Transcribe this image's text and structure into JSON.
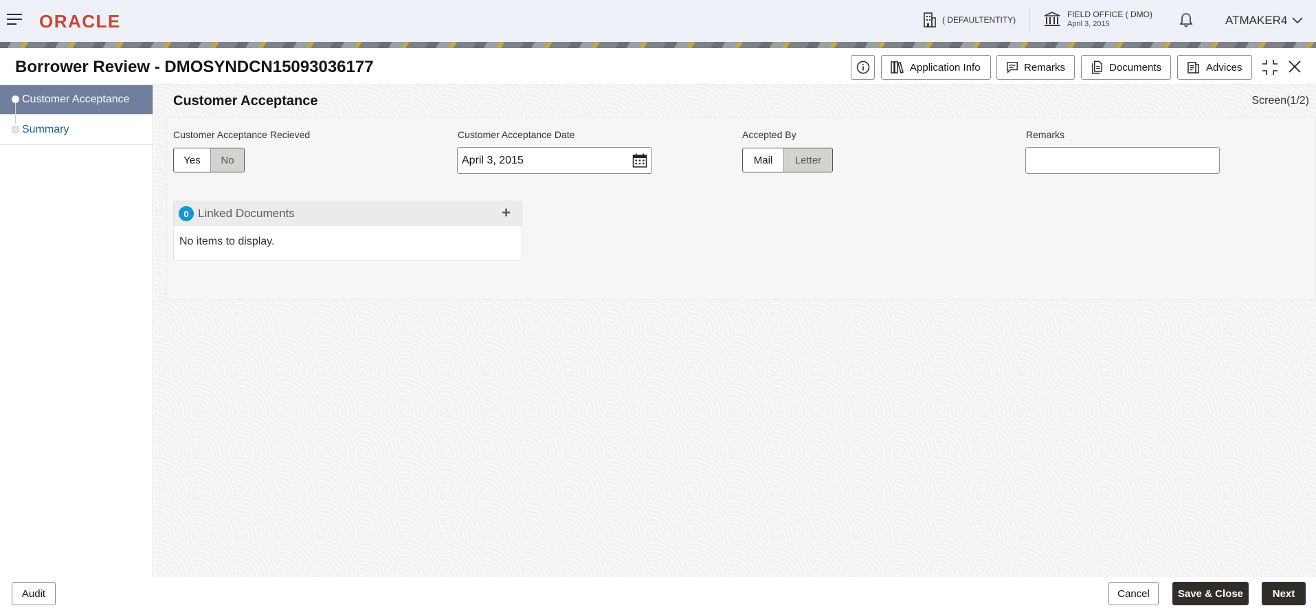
{
  "header": {
    "logo": "ORACLE",
    "entity": "( DEFAULTENTITY)",
    "office_name": "FIELD OFFICE ( DMO)",
    "office_date": "April 3, 2015",
    "user": "ATMAKER4"
  },
  "titlebar": {
    "title": "Borrower Review - DMOSYNDCN15093036177",
    "buttons": {
      "application_info": "Application Info",
      "remarks": "Remarks",
      "documents": "Documents",
      "advices": "Advices"
    }
  },
  "sidebar": {
    "items": [
      {
        "label": "Customer Acceptance",
        "active": true
      },
      {
        "label": "Summary",
        "active": false
      }
    ]
  },
  "main": {
    "section_title": "Customer Acceptance",
    "screen_indicator": "Screen(1/2)",
    "fields": {
      "acceptance_received": {
        "label": "Customer Acceptance Recieved",
        "options": [
          "Yes",
          "No"
        ],
        "selected": "Yes"
      },
      "acceptance_date": {
        "label": "Customer Acceptance Date",
        "value": "April 3, 2015"
      },
      "accepted_by": {
        "label": "Accepted By",
        "options": [
          "Mail",
          "Letter"
        ],
        "selected": "Mail"
      },
      "remarks": {
        "label": "Remarks",
        "value": ""
      }
    },
    "linked_documents": {
      "count": "0",
      "title": "Linked Documents",
      "empty_text": "No items to display."
    }
  },
  "footer": {
    "audit": "Audit",
    "cancel": "Cancel",
    "save_close": "Save & Close",
    "next": "Next"
  },
  "colors": {
    "brand": "#c74634",
    "sidebar_active": "#6f7f9d",
    "badge": "#1596d4",
    "primary_button": "#312d2a"
  }
}
